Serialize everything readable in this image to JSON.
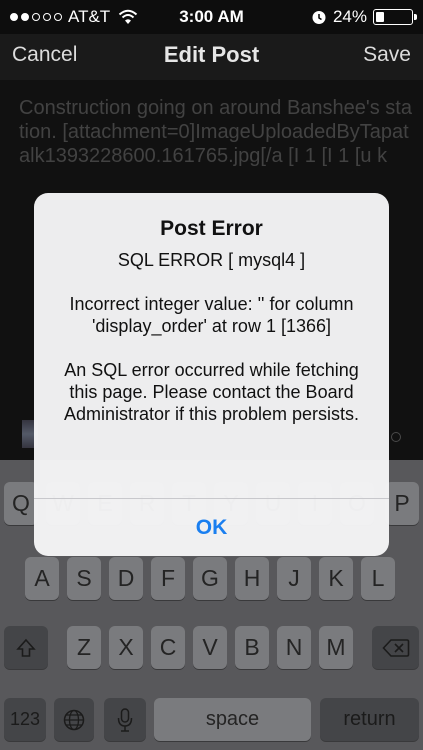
{
  "status_bar": {
    "carrier": "AT&T",
    "time": "3:00 AM",
    "battery": "24%",
    "signal_bars": 2,
    "battery_level": 0.24
  },
  "nav": {
    "cancel_label": "Cancel",
    "title": "Edit Post",
    "save_label": "Save"
  },
  "post": {
    "body": "Construction going on around Banshee's station. [attachment=0]ImageUploadedByTapatalk1393228600.161765.jpg[/a [I 1 [I 1 [u k"
  },
  "alert": {
    "title": "Post Error",
    "line1": "SQL ERROR [ mysql4 ]",
    "line2": "Incorrect integer value: '' for column 'display_order' at row 1 [1366]",
    "line3": "An SQL error occurred while fetching this page. Please contact the Board Administrator if this problem persists.",
    "ok_label": "OK"
  },
  "keyboard": {
    "row1": [
      "Q",
      "W",
      "E",
      "R",
      "T",
      "Y",
      "U",
      "I",
      "O",
      "P"
    ],
    "row2": [
      "A",
      "S",
      "D",
      "F",
      "G",
      "H",
      "J",
      "K",
      "L"
    ],
    "row3": [
      "Z",
      "X",
      "C",
      "V",
      "B",
      "N",
      "M"
    ],
    "numbers_label": "123",
    "space_label": "space",
    "return_label": "return"
  }
}
